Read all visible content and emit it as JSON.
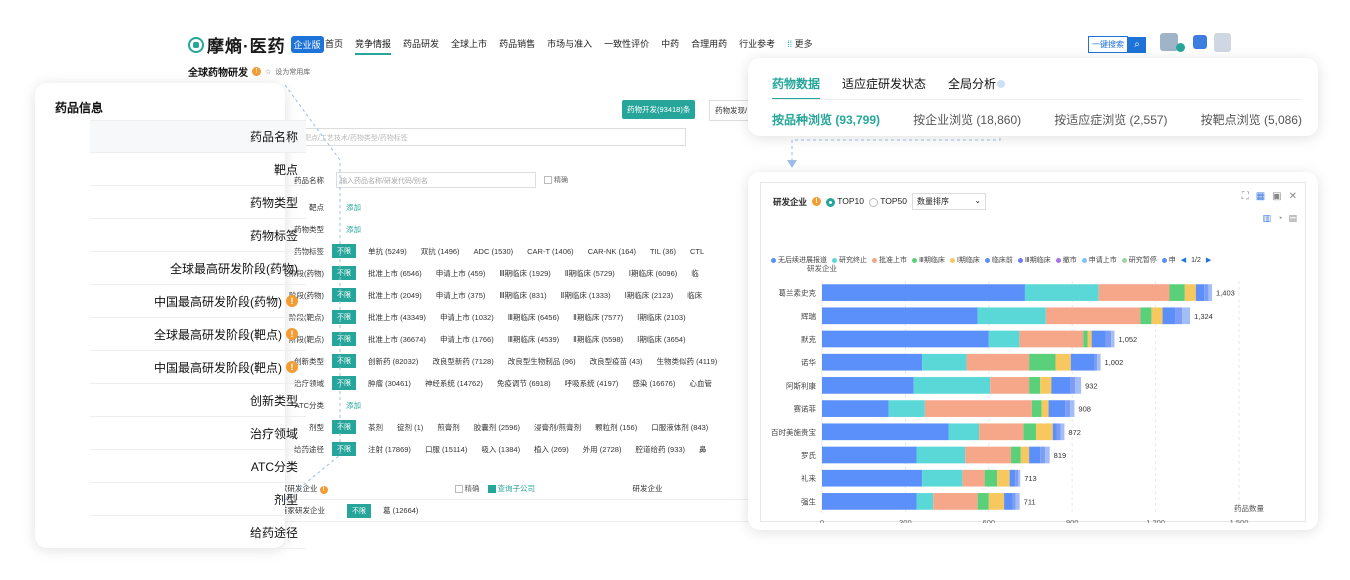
{
  "nav": {
    "logo_text": "摩熵·医药",
    "logo_badge": "企业版",
    "items": [
      "首页",
      "竞争情报",
      "药品研发",
      "全球上市",
      "药品销售",
      "市场与准入",
      "一致性评价",
      "中药",
      "合理用药",
      "行业参考",
      "更多"
    ],
    "active_index": 1,
    "one_key_search": "一键搜索"
  },
  "breadcrumb": {
    "title": "全球药物研发",
    "fav_label": "设为常用库"
  },
  "main": {
    "buttons": {
      "drug_dev": "药物开发(93418)条",
      "drug_found": "药物发现/"
    },
    "search_placeholder": "适应症/靶点/工艺技术/药物类型/药物标签",
    "drug_name_placeholder": "输入药品名称/研发代码/别名",
    "exact_label": "精确",
    "unlimited": "不限",
    "add_label": "添加",
    "filter_rows": [
      {
        "label": "药品名称",
        "kind": "input"
      },
      {
        "label": "靶点",
        "kind": "add"
      },
      {
        "label": "药物类型",
        "kind": "add"
      },
      {
        "label": "药物标签",
        "kind": "opts",
        "options": [
          "单抗 (5249)",
          "双抗 (1496)",
          "ADC (1530)",
          "CAR-T (1406)",
          "CAR-NK (164)",
          "TIL (36)",
          "CTL"
        ]
      },
      {
        "label": "研发阶段(药物)",
        "kind": "opts",
        "options": [
          "批准上市 (6546)",
          "申请上市 (459)",
          "Ⅲ期临床 (1929)",
          "Ⅱ期临床 (5729)",
          "Ⅰ期临床 (6096)",
          "临"
        ]
      },
      {
        "label": "阶段(药物)",
        "kind": "opts",
        "options": [
          "批准上市 (2049)",
          "申请上市 (375)",
          "Ⅲ期临床 (831)",
          "Ⅱ期临床 (1333)",
          "Ⅰ期临床 (2123)",
          "临床"
        ]
      },
      {
        "label": "阶段(靶点)",
        "kind": "opts",
        "options": [
          "批准上市 (43349)",
          "申请上市 (1032)",
          "Ⅲ期临床 (6456)",
          "Ⅱ期临床 (7577)",
          "Ⅰ期临床 (2103)"
        ]
      },
      {
        "label": "阶段(靶点)",
        "kind": "opts",
        "options": [
          "批准上市 (36674)",
          "申请上市 (1766)",
          "Ⅲ期临床 (4539)",
          "Ⅱ期临床 (5598)",
          "Ⅰ期临床 (3654)"
        ]
      },
      {
        "label": "创新类型",
        "kind": "opts",
        "options": [
          "创新药 (82032)",
          "改良型新药 (7128)",
          "改良型生物制品 (96)",
          "改良型疫苗 (43)",
          "生物类似药 (4119)"
        ]
      },
      {
        "label": "治疗领域",
        "kind": "opts",
        "options": [
          "肿瘤 (30461)",
          "神经系统 (14762)",
          "免疫调节 (6918)",
          "呼吸系统 (4197)",
          "感染 (16676)",
          "心血管"
        ]
      },
      {
        "label": "ATC分类",
        "kind": "add"
      },
      {
        "label": "剂型",
        "kind": "opts",
        "options": [
          "茶剂",
          "锭剂 (1)",
          "煎膏剂",
          "胶囊剂 (2596)",
          "浸膏剂/煎膏剂",
          "颗粒剂 (156)",
          "口服液体剂 (843)"
        ]
      },
      {
        "label": "给药途径",
        "kind": "opts",
        "options": [
          "注射 (17869)",
          "口服 (15114)",
          "吸入 (1384)",
          "植入 (269)",
          "外用 (2728)",
          "腔道给药 (933)",
          "鼻"
        ]
      }
    ],
    "bottom": {
      "row1_label": "家研发企业",
      "exact": "精确",
      "include_sub": "查询子公司",
      "column": "研发企业",
      "row2_label": "首家研发企业",
      "row2_value": "葛 (12664)"
    }
  },
  "left_card": {
    "title": "药品信息",
    "items": [
      "药品名称",
      "靶点",
      "药物类型",
      "药物标签",
      "全球最高研发阶段(药物)",
      "中国最高研发阶段(药物)",
      "全球最高研发阶段(靶点)",
      "中国最高研发阶段(靶点)",
      "创新类型",
      "治疗领域",
      "ATC分类",
      "剂型",
      "给药途径"
    ],
    "info_items": [
      5,
      6,
      7
    ]
  },
  "top_card": {
    "tabs": [
      "药物数据",
      "适应症研发状态",
      "全局分析"
    ],
    "sub_tabs": [
      "按品种浏览 (93,799)",
      "按企业浏览 (18,860)",
      "按适应症浏览 (2,557)",
      "按靶点浏览 (5,086)"
    ]
  },
  "chart_card": {
    "title": "研发企业",
    "radio_top10": "TOP10",
    "radio_top50": "TOP50",
    "sort_label": "数量排序",
    "page": "1/2"
  },
  "chart_data": {
    "type": "bar",
    "orientation": "horizontal",
    "stacked": true,
    "ylabel": "研发企业",
    "xlabel": "药品数量",
    "xlim": [
      0,
      1500
    ],
    "xticks": [
      0,
      300,
      600,
      900,
      1200,
      1500
    ],
    "xtick_labels": [
      "0",
      "300",
      "600",
      "900",
      "1,200",
      "1,500"
    ],
    "categories": [
      "葛兰素史克",
      "辉瑞",
      "默克",
      "诺华",
      "阿斯利康",
      "赛诺菲",
      "百时美施贵宝",
      "罗氏",
      "礼来",
      "强生"
    ],
    "totals": [
      1403,
      1324,
      1052,
      1002,
      932,
      908,
      872,
      819,
      713,
      711
    ],
    "total_labels": [
      "1,403",
      "1,324",
      "1,052",
      "1,002",
      "932",
      "908",
      "872",
      "819",
      "713",
      "711"
    ],
    "legend": [
      "无后续进展报道",
      "研究终止",
      "批准上市",
      "Ⅲ期临床",
      "Ⅰ期临床",
      "临床前",
      "Ⅲ期临床",
      "撤市",
      "申请上市",
      "研究暂停",
      "申"
    ],
    "series": [
      {
        "name": "无后续进展报道",
        "color": "#5b8ff9",
        "values": [
          730,
          560,
          600,
          360,
          330,
          240,
          455,
          340,
          360,
          340
        ]
      },
      {
        "name": "研究终止",
        "color": "#5ad8d8",
        "values": [
          265,
          245,
          110,
          160,
          275,
          130,
          110,
          175,
          145,
          60
        ]
      },
      {
        "name": "批准上市",
        "color": "#f6a789",
        "values": [
          255,
          340,
          230,
          225,
          140,
          385,
          160,
          165,
          80,
          160
        ]
      },
      {
        "name": "Ⅲ期临床",
        "color": "#5ad07a",
        "values": [
          55,
          40,
          15,
          95,
          40,
          35,
          45,
          35,
          45,
          40
        ]
      },
      {
        "name": "Ⅰ期临床",
        "color": "#f6c85f",
        "values": [
          40,
          40,
          15,
          55,
          40,
          25,
          60,
          30,
          45,
          55
        ]
      },
      {
        "name": "临床前",
        "color": "#5b8ff9",
        "values": [
          30,
          45,
          50,
          85,
          70,
          60,
          15,
          40,
          20,
          30
        ]
      },
      {
        "name": "Ⅲ期临床",
        "color": "#7c9cf5",
        "values": [
          15,
          25,
          20,
          10,
          15,
          18,
          14,
          17,
          10,
          12
        ]
      },
      {
        "name": "撤市",
        "color": "#a3bdf7",
        "values": [
          13,
          29,
          12,
          12,
          22,
          15,
          13,
          17,
          8,
          14
        ]
      }
    ]
  }
}
